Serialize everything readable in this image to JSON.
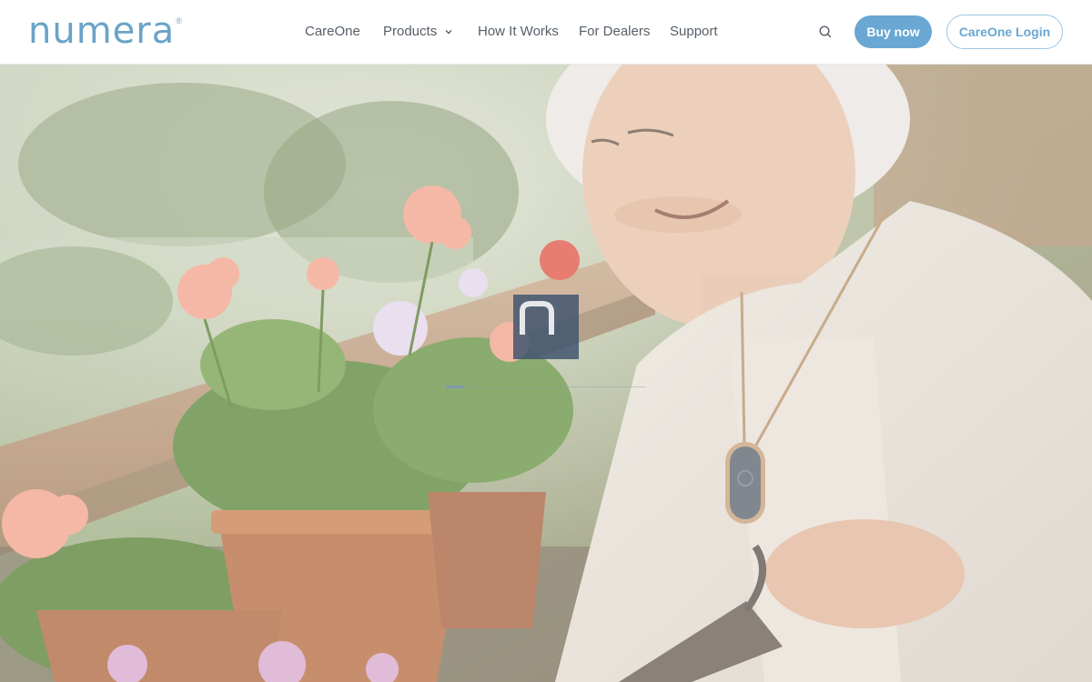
{
  "brand": {
    "name": "numera",
    "registered_mark": "®",
    "accent_color": "#6aa3c8"
  },
  "nav": {
    "items": [
      {
        "label": "CareOne"
      },
      {
        "label": "Products",
        "has_dropdown": true
      },
      {
        "label": "How It Works"
      },
      {
        "label": "For Dealers"
      },
      {
        "label": "Support"
      }
    ],
    "search_icon": "search-icon"
  },
  "actions": {
    "buy_label": "Buy now",
    "login_label": "CareOne Login",
    "button_color": "#6aa7d3"
  },
  "hero": {
    "loader_letter": "n",
    "loading_progress": 0.09
  }
}
